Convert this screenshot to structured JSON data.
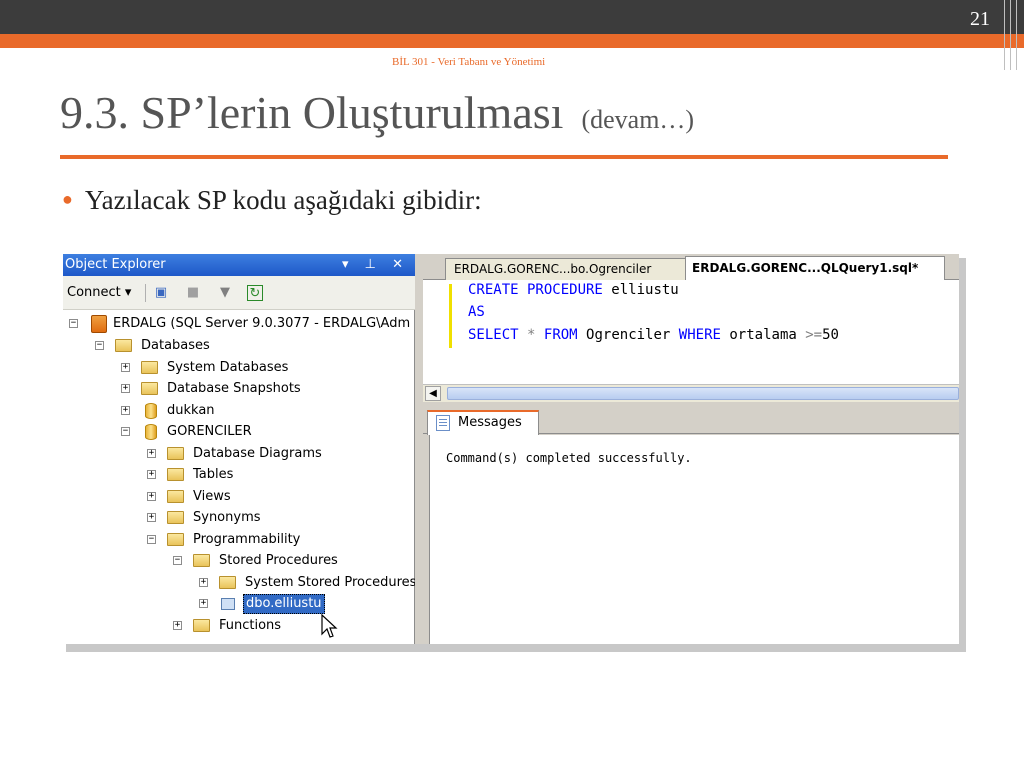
{
  "slide": {
    "number": "21",
    "subtitle": "BİL 301 - Veri Tabanı ve Yönetimi",
    "title": "9.3. SP’lerin Oluşturulması",
    "title_suffix": "(devam…)",
    "bullet": "Yazılacak SP kodu aşağıdaki gibidir:",
    "accent_color": "#e96a2a"
  },
  "object_explorer": {
    "title": "Object Explorer",
    "title_icons": "▾ ⊥ ✕",
    "connect_label": "Connect ▾",
    "tree": [
      {
        "label": "ERDALG (SQL Server 9.0.3077 - ERDALG\\Adm",
        "icon": "server-icon",
        "expander": "−"
      },
      {
        "label": "Databases",
        "icon": "folder-icon",
        "expander": "−"
      },
      {
        "label": "System Databases",
        "icon": "folder-icon",
        "expander": "+"
      },
      {
        "label": "Database Snapshots",
        "icon": "folder-icon",
        "expander": "+"
      },
      {
        "label": "dukkan",
        "icon": "database-icon",
        "expander": "+"
      },
      {
        "label": "GORENCILER",
        "icon": "database-icon",
        "expander": "−"
      },
      {
        "label": "Database Diagrams",
        "icon": "folder-icon",
        "expander": "+"
      },
      {
        "label": "Tables",
        "icon": "folder-icon",
        "expander": "+"
      },
      {
        "label": "Views",
        "icon": "folder-icon",
        "expander": "+"
      },
      {
        "label": "Synonyms",
        "icon": "folder-icon",
        "expander": "+"
      },
      {
        "label": "Programmability",
        "icon": "folder-icon",
        "expander": "−"
      },
      {
        "label": "Stored Procedures",
        "icon": "folder-icon",
        "expander": "−"
      },
      {
        "label": "System Stored Procedures",
        "icon": "folder-icon",
        "expander": "+"
      },
      {
        "label": "dbo.elliustu",
        "icon": "stored-procedure-icon",
        "expander": "+"
      },
      {
        "label": "Functions",
        "icon": "folder-icon",
        "expander": "+"
      }
    ]
  },
  "editor": {
    "tabs": [
      {
        "label": "ERDALG.GORENC...bo.Ogrenciler"
      },
      {
        "label": "ERDALG.GORENC...QLQuery1.sql*"
      }
    ],
    "code": {
      "line1_kw": "CREATE PROCEDURE",
      "line1_name": "elliustu",
      "line2_kw": "AS",
      "line3_select": "SELECT",
      "line3_star": "*",
      "line3_from": "FROM",
      "line3_table": "Ogrenciler",
      "line3_where": "WHERE",
      "line3_col": "ortalama",
      "line3_op": ">=",
      "line3_val": "50"
    },
    "messages_tab": "Messages",
    "message": "Command(s) completed successfully."
  }
}
